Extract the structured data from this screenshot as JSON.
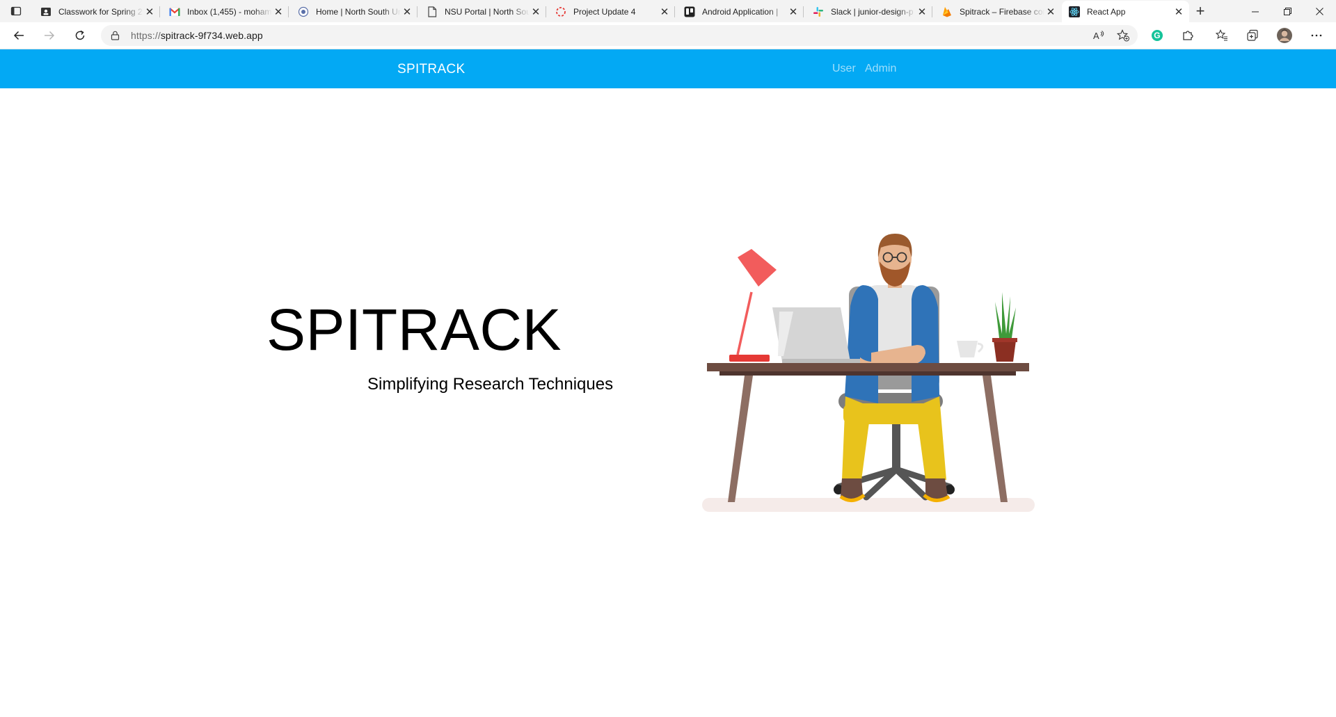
{
  "browser": {
    "tabs": [
      {
        "title": "Classwork for Spring 2",
        "icon": "classroom-icon"
      },
      {
        "title": "Inbox (1,455) - mohamm",
        "icon": "gmail-icon"
      },
      {
        "title": "Home | North South Un",
        "icon": "university-icon"
      },
      {
        "title": "NSU Portal | North Sou",
        "icon": "page-icon"
      },
      {
        "title": "Project Update 4",
        "icon": "loading-icon"
      },
      {
        "title": "Android Application |",
        "icon": "trello-icon"
      },
      {
        "title": "Slack | junior-design-p",
        "icon": "slack-icon"
      },
      {
        "title": "Spitrack – Firebase con",
        "icon": "firebase-icon"
      },
      {
        "title": "React App",
        "icon": "react-icon"
      }
    ],
    "active_tab": 8,
    "url_scheme": "https://",
    "url_host": "spitrack-9f734.web.app"
  },
  "navbar": {
    "brand": "SPITRACK",
    "links": [
      "User",
      "Admin"
    ]
  },
  "hero": {
    "title": "SPITRACK",
    "subtitle": "Simplifying Research Techniques"
  },
  "colors": {
    "navbar": "#03a9f4",
    "lamp": "#f25c5c",
    "desk": "#8d6e63",
    "jacket": "#2f73b8",
    "pants": "#e8c31c"
  }
}
